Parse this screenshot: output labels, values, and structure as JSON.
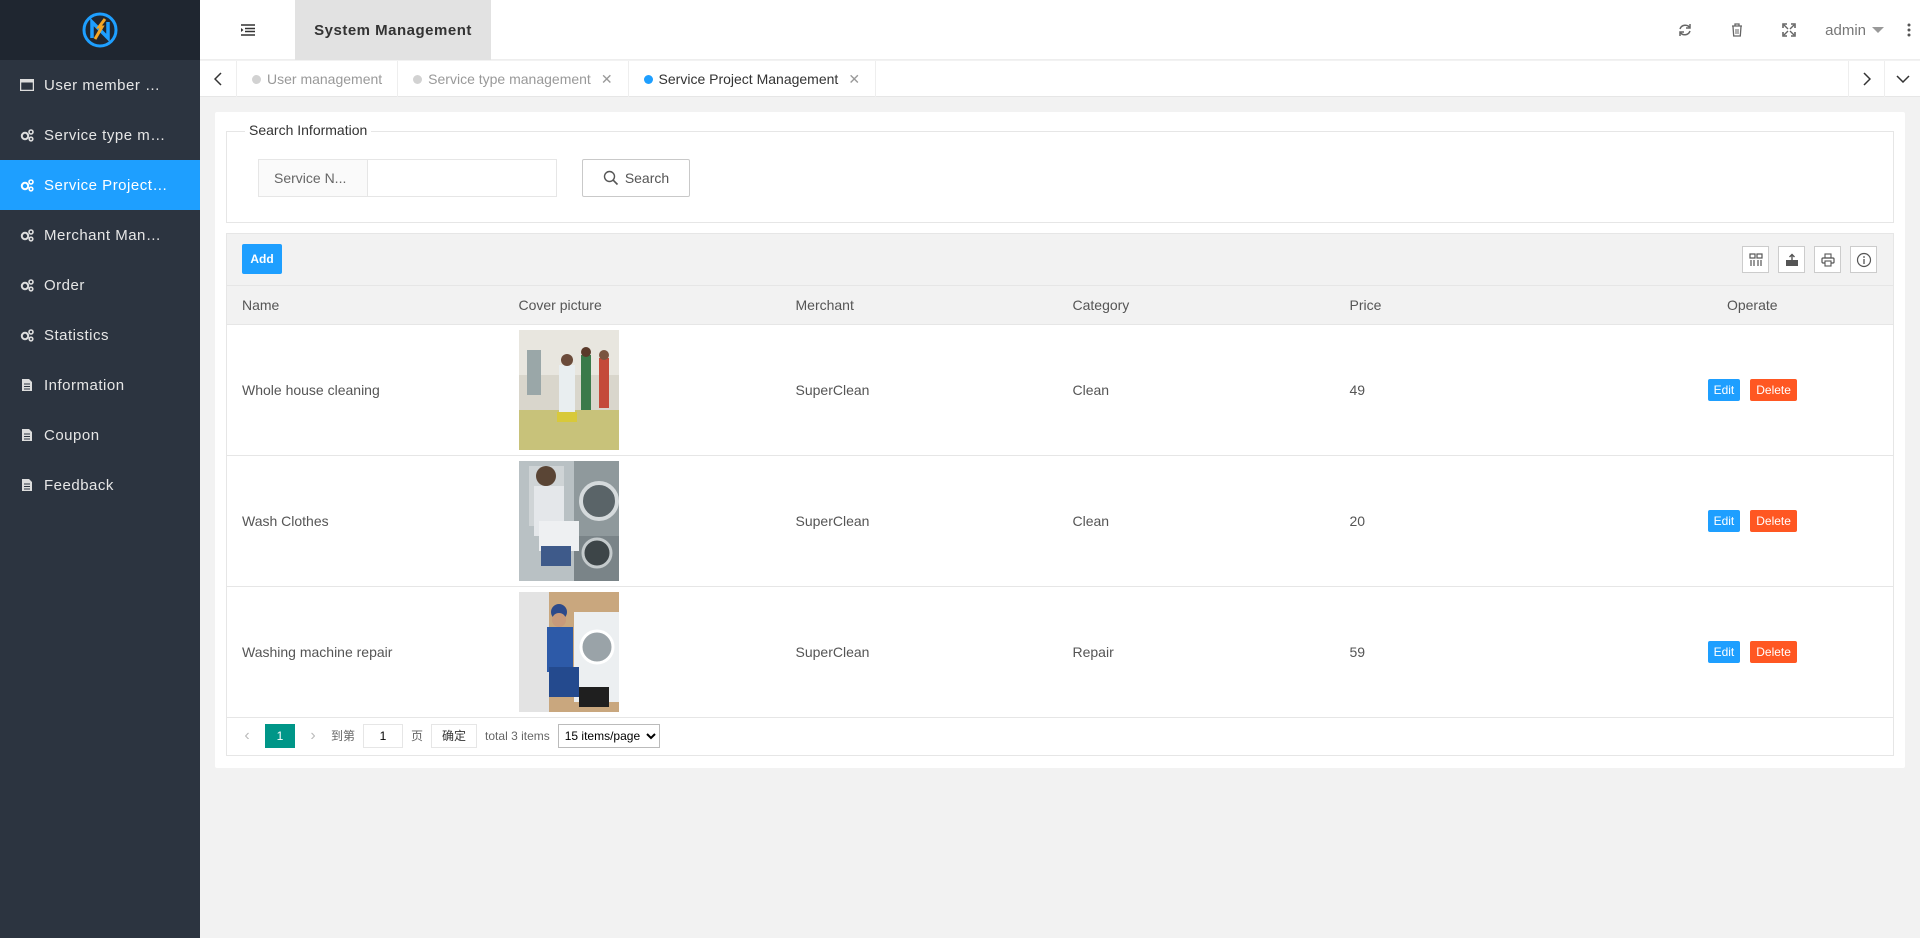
{
  "sidebar": {
    "items": [
      {
        "label": "User member management",
        "icon": "window-icon",
        "active": false
      },
      {
        "label": "Service type management",
        "icon": "gears-icon",
        "active": false
      },
      {
        "label": "Service Project Management",
        "icon": "gears-icon",
        "active": true
      },
      {
        "label": "Merchant Management",
        "icon": "gears-icon",
        "active": false
      },
      {
        "label": "Order",
        "icon": "gears-icon",
        "active": false
      },
      {
        "label": "Statistics",
        "icon": "gears-icon",
        "active": false
      },
      {
        "label": "Information",
        "icon": "file-icon",
        "active": false
      },
      {
        "label": "Coupon",
        "icon": "file-icon",
        "active": false
      },
      {
        "label": "Feedback",
        "icon": "file-icon",
        "active": false
      }
    ]
  },
  "header": {
    "system_tab": "System Management",
    "user": "admin"
  },
  "tabs": [
    {
      "label": "User management",
      "closable": false,
      "active": false
    },
    {
      "label": "Service type management",
      "closable": true,
      "active": false
    },
    {
      "label": "Service Project Management",
      "closable": true,
      "active": true
    }
  ],
  "search": {
    "legend": "Search Information",
    "label": "Service N...",
    "value": "",
    "button": "Search"
  },
  "toolbar": {
    "add_label": "Add"
  },
  "table": {
    "headers": [
      "Name",
      "Cover picture",
      "Merchant",
      "Category",
      "Price",
      "Operate"
    ],
    "rows": [
      {
        "name": "Whole house cleaning",
        "merchant": "SuperClean",
        "category": "Clean",
        "price": "49"
      },
      {
        "name": "Wash Clothes",
        "merchant": "SuperClean",
        "category": "Clean",
        "price": "20"
      },
      {
        "name": "Washing machine repair",
        "merchant": "SuperClean",
        "category": "Repair",
        "price": "59"
      }
    ],
    "edit_label": "Edit",
    "delete_label": "Delete"
  },
  "pager": {
    "current": "1",
    "goto_prefix": "到第",
    "goto_value": "1",
    "goto_suffix": "页",
    "confirm": "确定",
    "total": "total 3 items",
    "page_size": "15 items/page"
  },
  "colors": {
    "sidebar_bg": "#2c3440",
    "accent": "#1e9fff",
    "danger": "#ff5722",
    "pager_active": "#009688"
  }
}
